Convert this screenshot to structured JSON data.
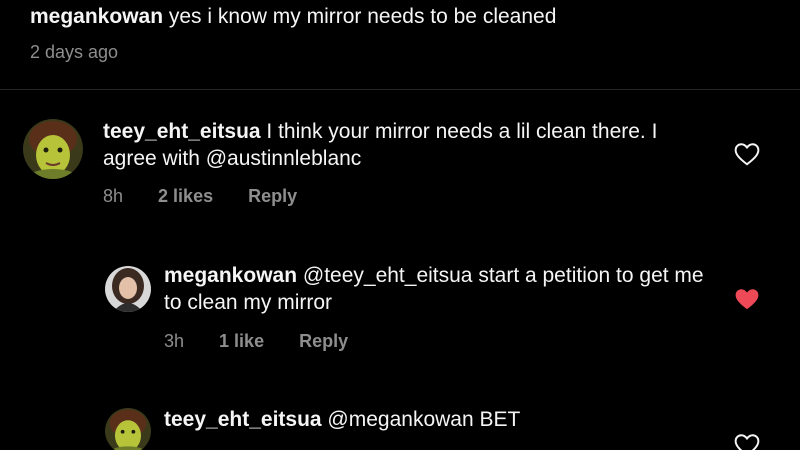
{
  "caption": {
    "username": "megankowan",
    "text": " yes i know my mirror needs to be cleaned",
    "time": "2 days ago"
  },
  "comments": [
    {
      "username": "teey_eht_eitsua",
      "text": " I think your mirror needs a lil clean there. I agree with @austinnleblanc",
      "time": "8h",
      "likes": "2 likes",
      "reply_label": "Reply",
      "liked": false,
      "avatar": "green-ogre-avatar"
    },
    {
      "username": "megankowan",
      "text": " @teey_eht_eitsua start a petition to get me to clean my mirror",
      "time": "3h",
      "likes": "1 like",
      "reply_label": "Reply",
      "liked": true,
      "avatar": "woman-portrait-avatar"
    },
    {
      "username": "teey_eht_eitsua",
      "text": " @megankowan BET",
      "liked": false,
      "avatar": "green-ogre-avatar"
    }
  ],
  "colors": {
    "background": "#000000",
    "text": "#f5f5f5",
    "muted": "#8e8e8e",
    "liked_heart": "#ed4956"
  }
}
